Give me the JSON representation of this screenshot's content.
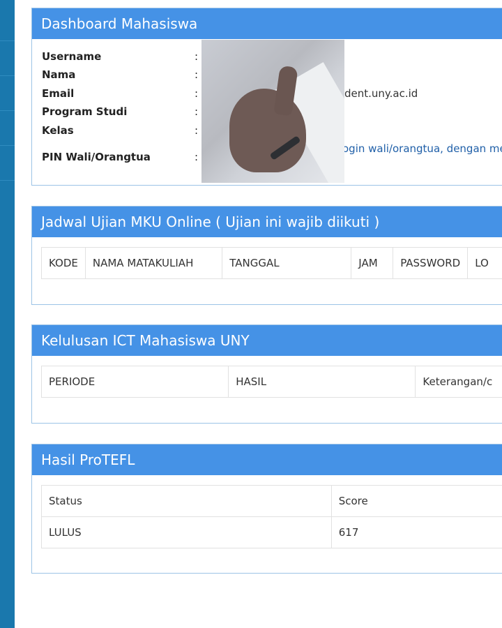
{
  "profile": {
    "title": "Dashboard Mahasiswa",
    "fields": [
      {
        "label": "Username",
        "colon": ":",
        "value": ""
      },
      {
        "label": "Nama",
        "colon": ":",
        "value": ""
      },
      {
        "label": "Email",
        "colon": ":",
        "value": "dent.uny.ac.id"
      },
      {
        "label": "Program Studi",
        "colon": ":",
        "value": ""
      },
      {
        "label": "Kelas",
        "colon": ":",
        "value": ""
      },
      {
        "label": "PIN Wali/Orangtua",
        "colon": ":",
        "value": "ogin wali/orangtua, dengan men"
      }
    ]
  },
  "exam": {
    "title": "Jadwal Ujian MKU Online ( Ujian ini wajib diikuti )",
    "headers": [
      "KODE",
      "NAMA MATAKULIAH",
      "TANGGAL",
      "JAM",
      "PASSWORD",
      "LO"
    ]
  },
  "ict": {
    "title": "Kelulusan ICT Mahasiswa UNY",
    "headers": [
      "PERIODE",
      "HASIL",
      "Keterangan/c"
    ]
  },
  "protefl": {
    "title": "Hasil ProTEFL",
    "headers": [
      "Status",
      "Score"
    ],
    "rows": [
      [
        "LULUS",
        "617"
      ]
    ]
  },
  "colors": {
    "header_blue": "#4592e6",
    "sidebar_blue": "#1a78ad",
    "link_blue": "#1f5fa8"
  }
}
